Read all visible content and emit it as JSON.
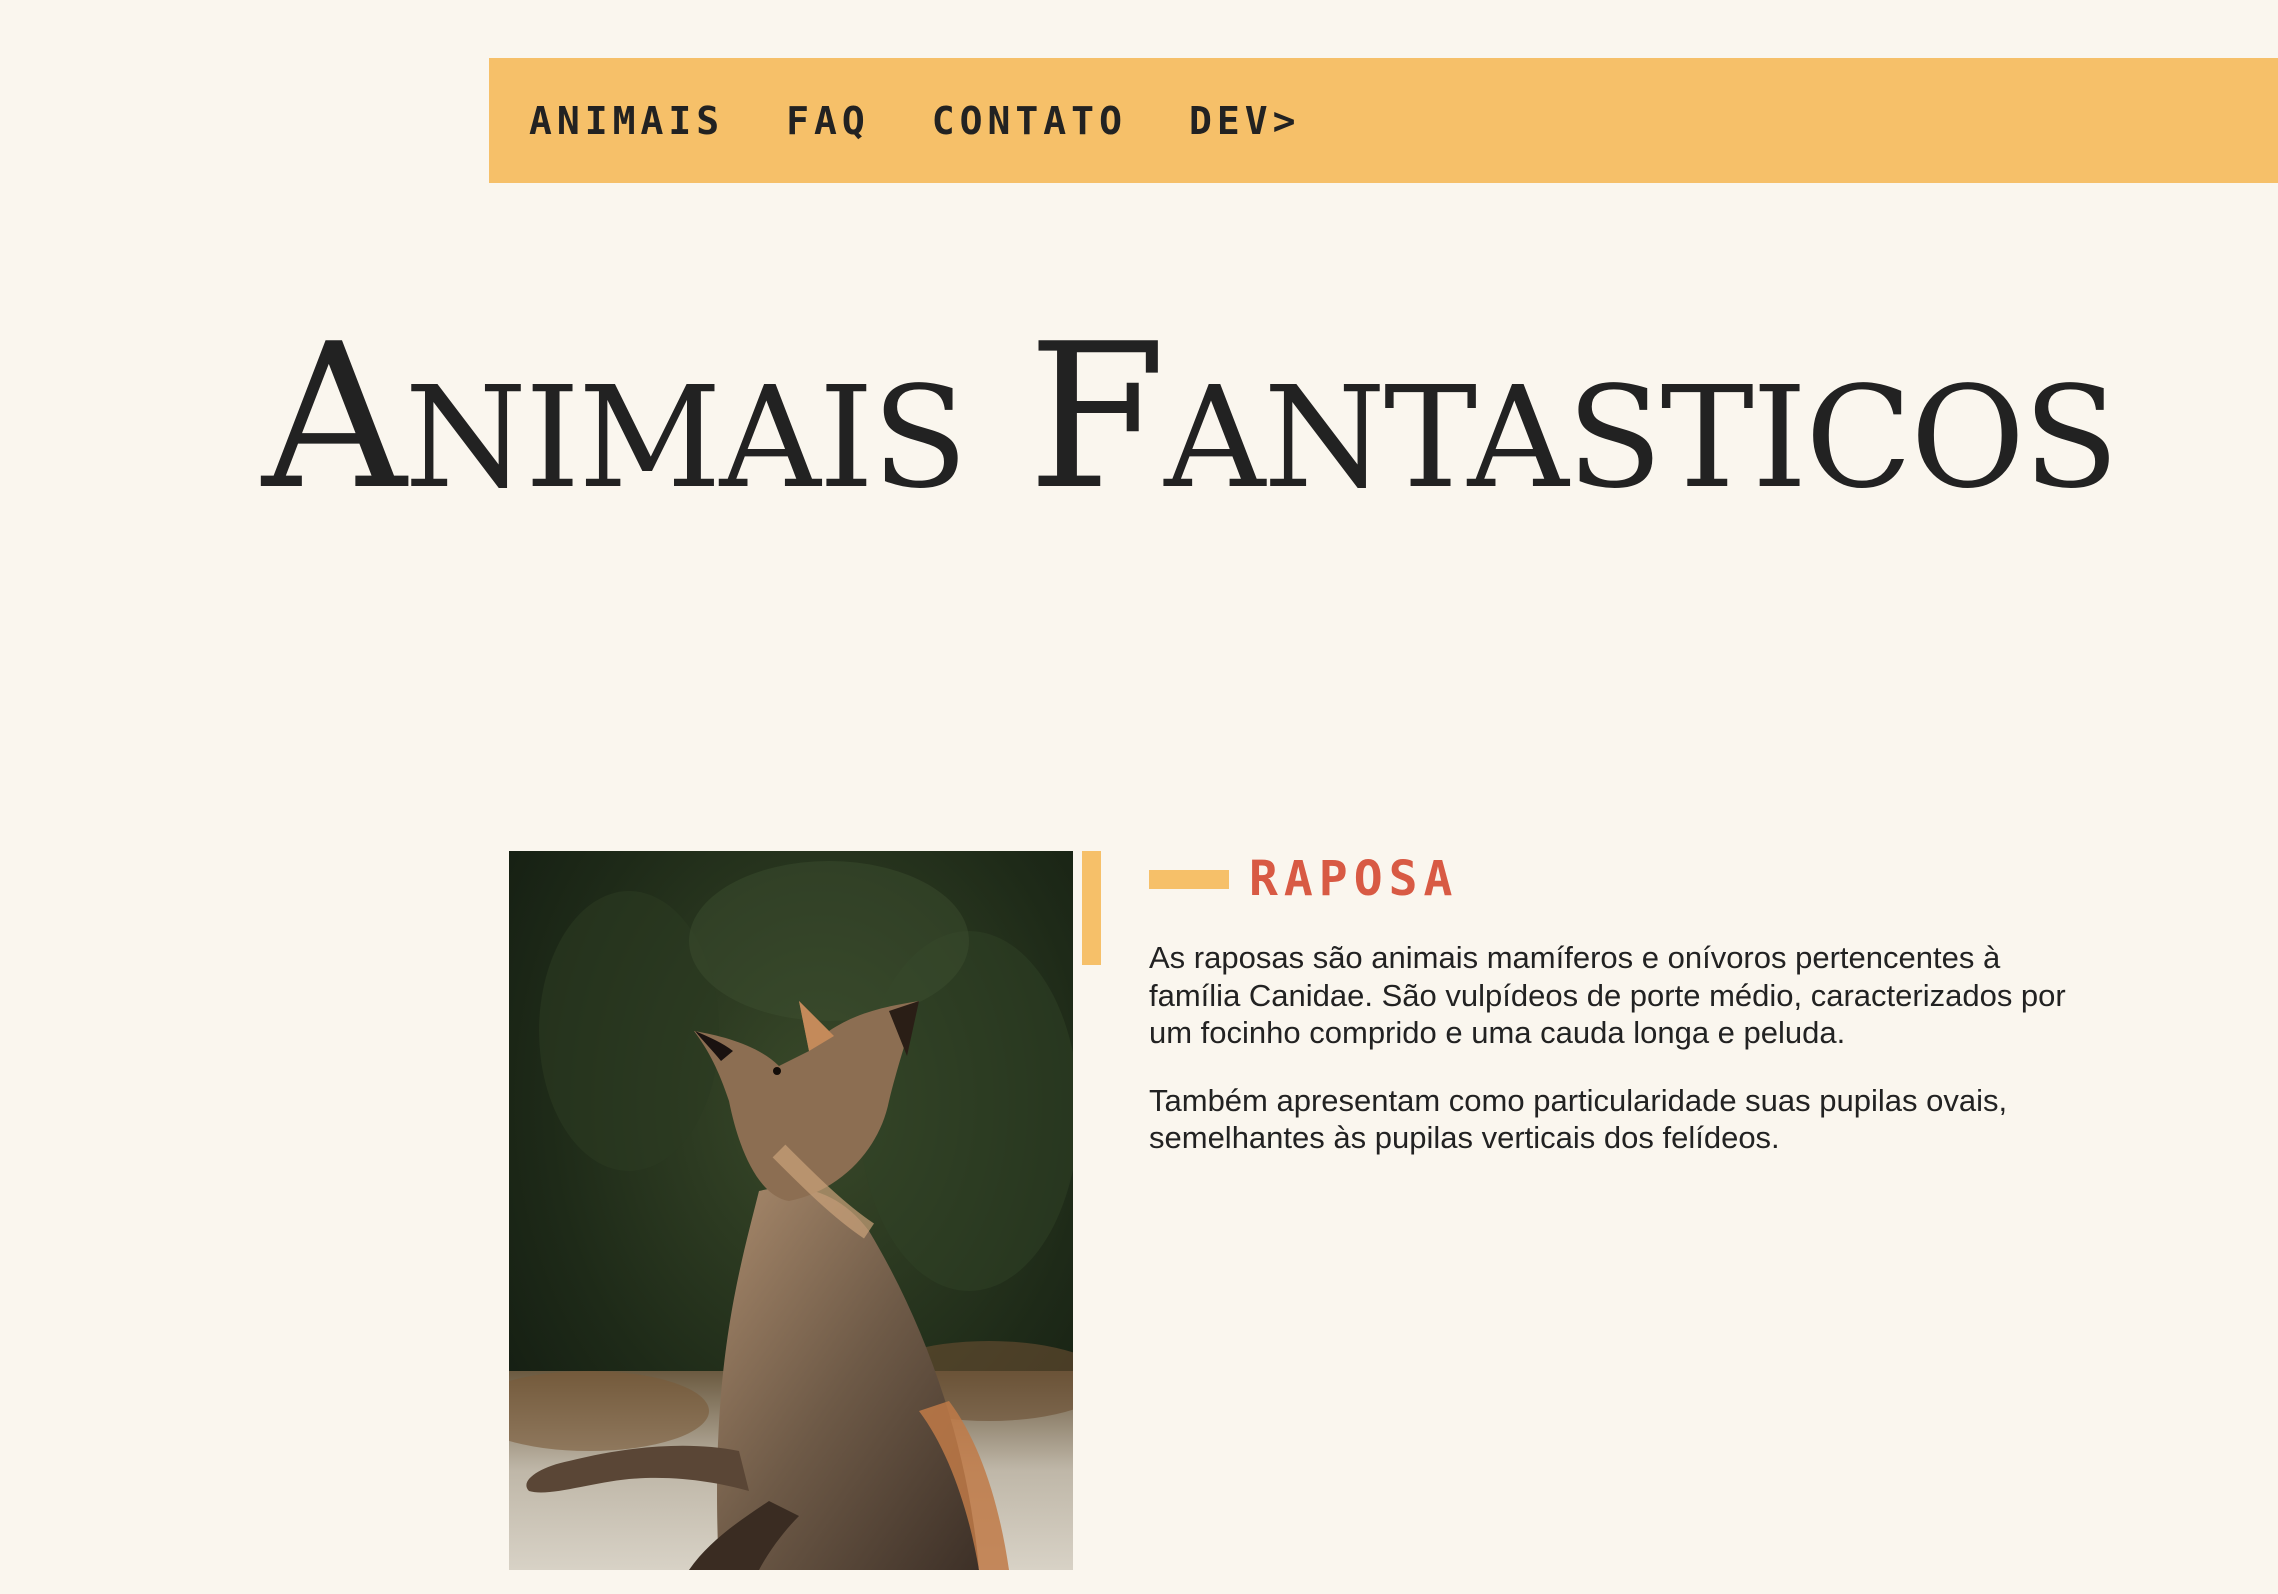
{
  "menu": {
    "items": [
      {
        "label": "ANIMAIS"
      },
      {
        "label": "FAQ"
      },
      {
        "label": "CONTATO"
      },
      {
        "label": "DEV>"
      }
    ]
  },
  "page": {
    "title": "Animais Fantasticos"
  },
  "animal": {
    "name": "RAPOSA",
    "image_subject": "fox",
    "paragraphs": [
      "As raposas são animais mamíferos e onívoros pertencentes à família Canidae. São vulpídeos de porte médio, caracterizados por um focinho comprido e uma cauda longa e peluda.",
      "Também apresentam como particularidade suas pupilas ovais, semelhantes às pupilas verticais dos felídeos."
    ]
  },
  "colors": {
    "background": "#FAF6EE",
    "menu_background": "#F6C069",
    "accent": "#F6C069",
    "heading_red": "#D85A44",
    "text": "#222222"
  }
}
